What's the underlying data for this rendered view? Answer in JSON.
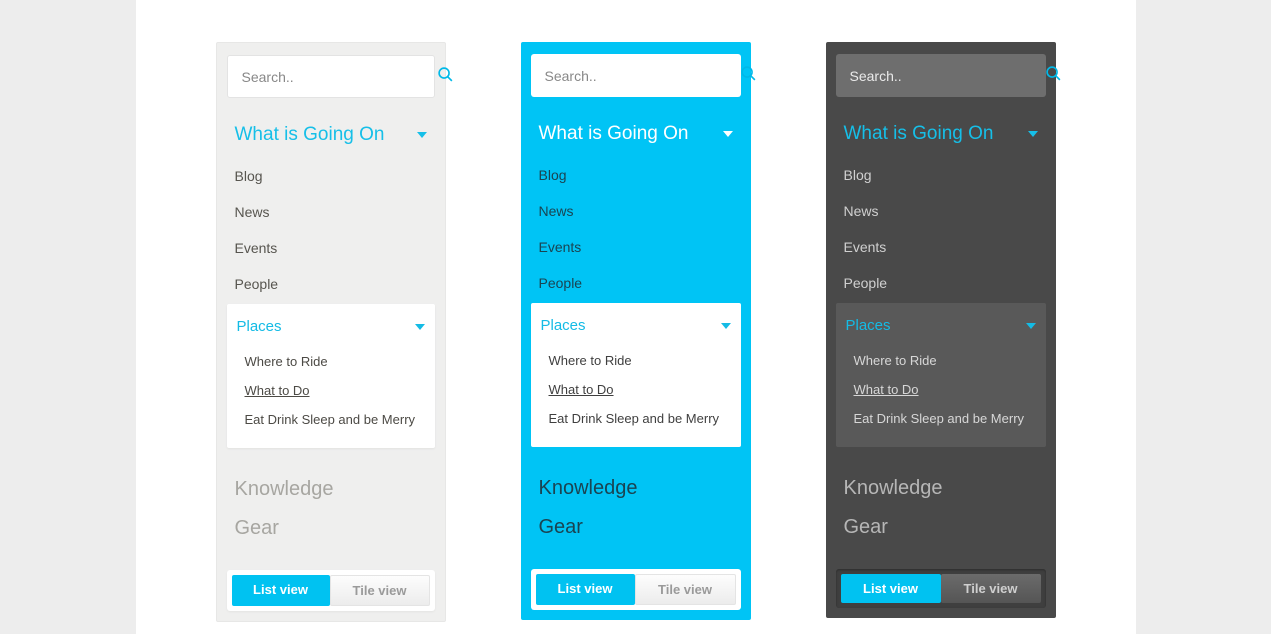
{
  "search": {
    "placeholder": "Search.."
  },
  "section": {
    "title": "What is Going On",
    "items": [
      "Blog",
      "News",
      "Events",
      "People"
    ]
  },
  "places": {
    "title": "Places",
    "items": [
      {
        "label": "Where to Ride",
        "active": false
      },
      {
        "label": "What to Do",
        "active": true
      },
      {
        "label": "Eat Drink Sleep and be Merry",
        "active": false
      }
    ]
  },
  "other_sections": [
    "Knowledge",
    "Gear"
  ],
  "toggle": {
    "list": "List view",
    "tile": "Tile view"
  },
  "themes": [
    "light",
    "cyan",
    "dark"
  ]
}
